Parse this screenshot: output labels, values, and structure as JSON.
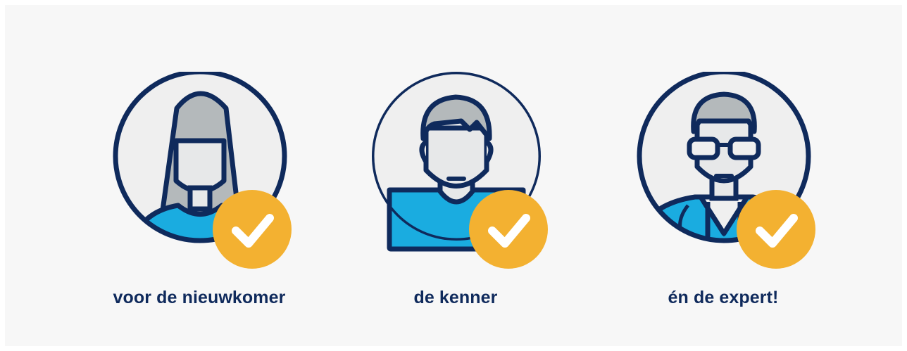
{
  "colors": {
    "background": "#f7f7f7",
    "outline": "#0f2a5c",
    "circle_fill": "#efefef",
    "hair_gray": "#b4b9bb",
    "skin": "#e7e8e9",
    "shirt_blue": "#1aace0",
    "check_badge": "#f3b131",
    "check_mark": "#ffffff"
  },
  "personas": [
    {
      "id": "newcomer",
      "icon": "woman-avatar-icon",
      "label": "voor de nieuwkomer"
    },
    {
      "id": "connoisseur",
      "icon": "man-avatar-icon",
      "label": "de kenner"
    },
    {
      "id": "expert",
      "icon": "doctor-with-glasses-icon",
      "label": "én de expert!"
    }
  ]
}
